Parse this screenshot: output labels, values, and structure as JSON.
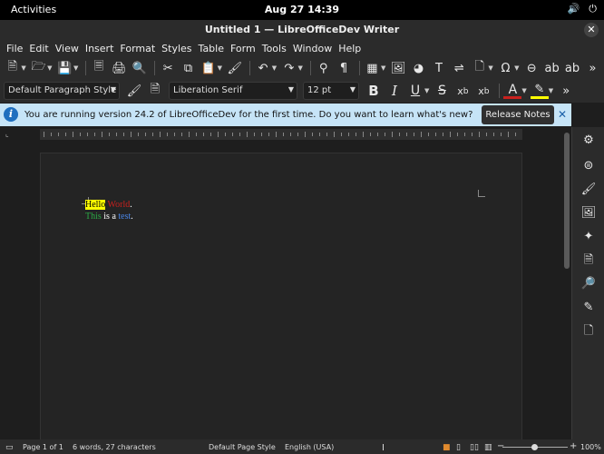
{
  "system": {
    "activities": "Activities",
    "clock": "Aug 27  14:39"
  },
  "window": {
    "title": "Untitled 1 — LibreOfficeDev Writer"
  },
  "menubar": [
    "File",
    "Edit",
    "View",
    "Insert",
    "Format",
    "Styles",
    "Table",
    "Form",
    "Tools",
    "Window",
    "Help"
  ],
  "toolbar2": {
    "paragraph_style": "Default Paragraph Style",
    "font_name": "Liberation Serif",
    "font_size": "12 pt"
  },
  "infobar": {
    "message": "You are running version 24.2 of LibreOfficeDev for the first time. Do you want to learn what's new?",
    "button": "Release Notes"
  },
  "document": {
    "line1": [
      {
        "text": "Hello",
        "color": "#000000",
        "highlight": "#ffff00"
      },
      {
        "text": " ",
        "color": "#ffffff"
      },
      {
        "text": "World",
        "color": "#c9211e"
      },
      {
        "text": ".",
        "color": "#ffffff"
      }
    ],
    "line2": [
      {
        "text": "This",
        "color": "#2aa845"
      },
      {
        "text": " is a ",
        "color": "#ffffff"
      },
      {
        "text": "test",
        "color": "#4a86e8"
      },
      {
        "text": ".",
        "color": "#ffffff"
      }
    ]
  },
  "statusbar": {
    "page": "Page 1 of 1",
    "words": "6 words, 27 characters",
    "page_style": "Default Page Style",
    "language": "English (USA)",
    "zoom": "100%"
  },
  "colors": {
    "accent": "#1f6fbf",
    "infobar_bg": "#c6e4f7"
  }
}
